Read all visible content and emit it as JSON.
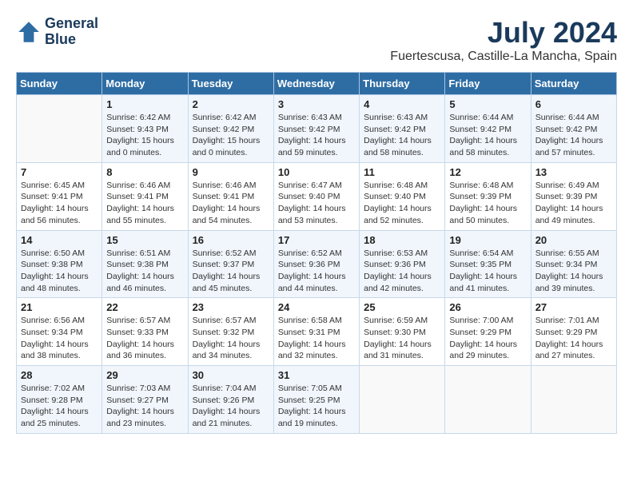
{
  "header": {
    "logo_line1": "General",
    "logo_line2": "Blue",
    "month": "July 2024",
    "location": "Fuertescusa, Castille-La Mancha, Spain"
  },
  "weekdays": [
    "Sunday",
    "Monday",
    "Tuesday",
    "Wednesday",
    "Thursday",
    "Friday",
    "Saturday"
  ],
  "weeks": [
    [
      {
        "day": "",
        "sunrise": "",
        "sunset": "",
        "daylight": ""
      },
      {
        "day": "1",
        "sunrise": "Sunrise: 6:42 AM",
        "sunset": "Sunset: 9:43 PM",
        "daylight": "Daylight: 15 hours and 0 minutes."
      },
      {
        "day": "2",
        "sunrise": "Sunrise: 6:42 AM",
        "sunset": "Sunset: 9:42 PM",
        "daylight": "Daylight: 15 hours and 0 minutes."
      },
      {
        "day": "3",
        "sunrise": "Sunrise: 6:43 AM",
        "sunset": "Sunset: 9:42 PM",
        "daylight": "Daylight: 14 hours and 59 minutes."
      },
      {
        "day": "4",
        "sunrise": "Sunrise: 6:43 AM",
        "sunset": "Sunset: 9:42 PM",
        "daylight": "Daylight: 14 hours and 58 minutes."
      },
      {
        "day": "5",
        "sunrise": "Sunrise: 6:44 AM",
        "sunset": "Sunset: 9:42 PM",
        "daylight": "Daylight: 14 hours and 58 minutes."
      },
      {
        "day": "6",
        "sunrise": "Sunrise: 6:44 AM",
        "sunset": "Sunset: 9:42 PM",
        "daylight": "Daylight: 14 hours and 57 minutes."
      }
    ],
    [
      {
        "day": "7",
        "sunrise": "Sunrise: 6:45 AM",
        "sunset": "Sunset: 9:41 PM",
        "daylight": "Daylight: 14 hours and 56 minutes."
      },
      {
        "day": "8",
        "sunrise": "Sunrise: 6:46 AM",
        "sunset": "Sunset: 9:41 PM",
        "daylight": "Daylight: 14 hours and 55 minutes."
      },
      {
        "day": "9",
        "sunrise": "Sunrise: 6:46 AM",
        "sunset": "Sunset: 9:41 PM",
        "daylight": "Daylight: 14 hours and 54 minutes."
      },
      {
        "day": "10",
        "sunrise": "Sunrise: 6:47 AM",
        "sunset": "Sunset: 9:40 PM",
        "daylight": "Daylight: 14 hours and 53 minutes."
      },
      {
        "day": "11",
        "sunrise": "Sunrise: 6:48 AM",
        "sunset": "Sunset: 9:40 PM",
        "daylight": "Daylight: 14 hours and 52 minutes."
      },
      {
        "day": "12",
        "sunrise": "Sunrise: 6:48 AM",
        "sunset": "Sunset: 9:39 PM",
        "daylight": "Daylight: 14 hours and 50 minutes."
      },
      {
        "day": "13",
        "sunrise": "Sunrise: 6:49 AM",
        "sunset": "Sunset: 9:39 PM",
        "daylight": "Daylight: 14 hours and 49 minutes."
      }
    ],
    [
      {
        "day": "14",
        "sunrise": "Sunrise: 6:50 AM",
        "sunset": "Sunset: 9:38 PM",
        "daylight": "Daylight: 14 hours and 48 minutes."
      },
      {
        "day": "15",
        "sunrise": "Sunrise: 6:51 AM",
        "sunset": "Sunset: 9:38 PM",
        "daylight": "Daylight: 14 hours and 46 minutes."
      },
      {
        "day": "16",
        "sunrise": "Sunrise: 6:52 AM",
        "sunset": "Sunset: 9:37 PM",
        "daylight": "Daylight: 14 hours and 45 minutes."
      },
      {
        "day": "17",
        "sunrise": "Sunrise: 6:52 AM",
        "sunset": "Sunset: 9:36 PM",
        "daylight": "Daylight: 14 hours and 44 minutes."
      },
      {
        "day": "18",
        "sunrise": "Sunrise: 6:53 AM",
        "sunset": "Sunset: 9:36 PM",
        "daylight": "Daylight: 14 hours and 42 minutes."
      },
      {
        "day": "19",
        "sunrise": "Sunrise: 6:54 AM",
        "sunset": "Sunset: 9:35 PM",
        "daylight": "Daylight: 14 hours and 41 minutes."
      },
      {
        "day": "20",
        "sunrise": "Sunrise: 6:55 AM",
        "sunset": "Sunset: 9:34 PM",
        "daylight": "Daylight: 14 hours and 39 minutes."
      }
    ],
    [
      {
        "day": "21",
        "sunrise": "Sunrise: 6:56 AM",
        "sunset": "Sunset: 9:34 PM",
        "daylight": "Daylight: 14 hours and 38 minutes."
      },
      {
        "day": "22",
        "sunrise": "Sunrise: 6:57 AM",
        "sunset": "Sunset: 9:33 PM",
        "daylight": "Daylight: 14 hours and 36 minutes."
      },
      {
        "day": "23",
        "sunrise": "Sunrise: 6:57 AM",
        "sunset": "Sunset: 9:32 PM",
        "daylight": "Daylight: 14 hours and 34 minutes."
      },
      {
        "day": "24",
        "sunrise": "Sunrise: 6:58 AM",
        "sunset": "Sunset: 9:31 PM",
        "daylight": "Daylight: 14 hours and 32 minutes."
      },
      {
        "day": "25",
        "sunrise": "Sunrise: 6:59 AM",
        "sunset": "Sunset: 9:30 PM",
        "daylight": "Daylight: 14 hours and 31 minutes."
      },
      {
        "day": "26",
        "sunrise": "Sunrise: 7:00 AM",
        "sunset": "Sunset: 9:29 PM",
        "daylight": "Daylight: 14 hours and 29 minutes."
      },
      {
        "day": "27",
        "sunrise": "Sunrise: 7:01 AM",
        "sunset": "Sunset: 9:29 PM",
        "daylight": "Daylight: 14 hours and 27 minutes."
      }
    ],
    [
      {
        "day": "28",
        "sunrise": "Sunrise: 7:02 AM",
        "sunset": "Sunset: 9:28 PM",
        "daylight": "Daylight: 14 hours and 25 minutes."
      },
      {
        "day": "29",
        "sunrise": "Sunrise: 7:03 AM",
        "sunset": "Sunset: 9:27 PM",
        "daylight": "Daylight: 14 hours and 23 minutes."
      },
      {
        "day": "30",
        "sunrise": "Sunrise: 7:04 AM",
        "sunset": "Sunset: 9:26 PM",
        "daylight": "Daylight: 14 hours and 21 minutes."
      },
      {
        "day": "31",
        "sunrise": "Sunrise: 7:05 AM",
        "sunset": "Sunset: 9:25 PM",
        "daylight": "Daylight: 14 hours and 19 minutes."
      },
      {
        "day": "",
        "sunrise": "",
        "sunset": "",
        "daylight": ""
      },
      {
        "day": "",
        "sunrise": "",
        "sunset": "",
        "daylight": ""
      },
      {
        "day": "",
        "sunrise": "",
        "sunset": "",
        "daylight": ""
      }
    ]
  ]
}
